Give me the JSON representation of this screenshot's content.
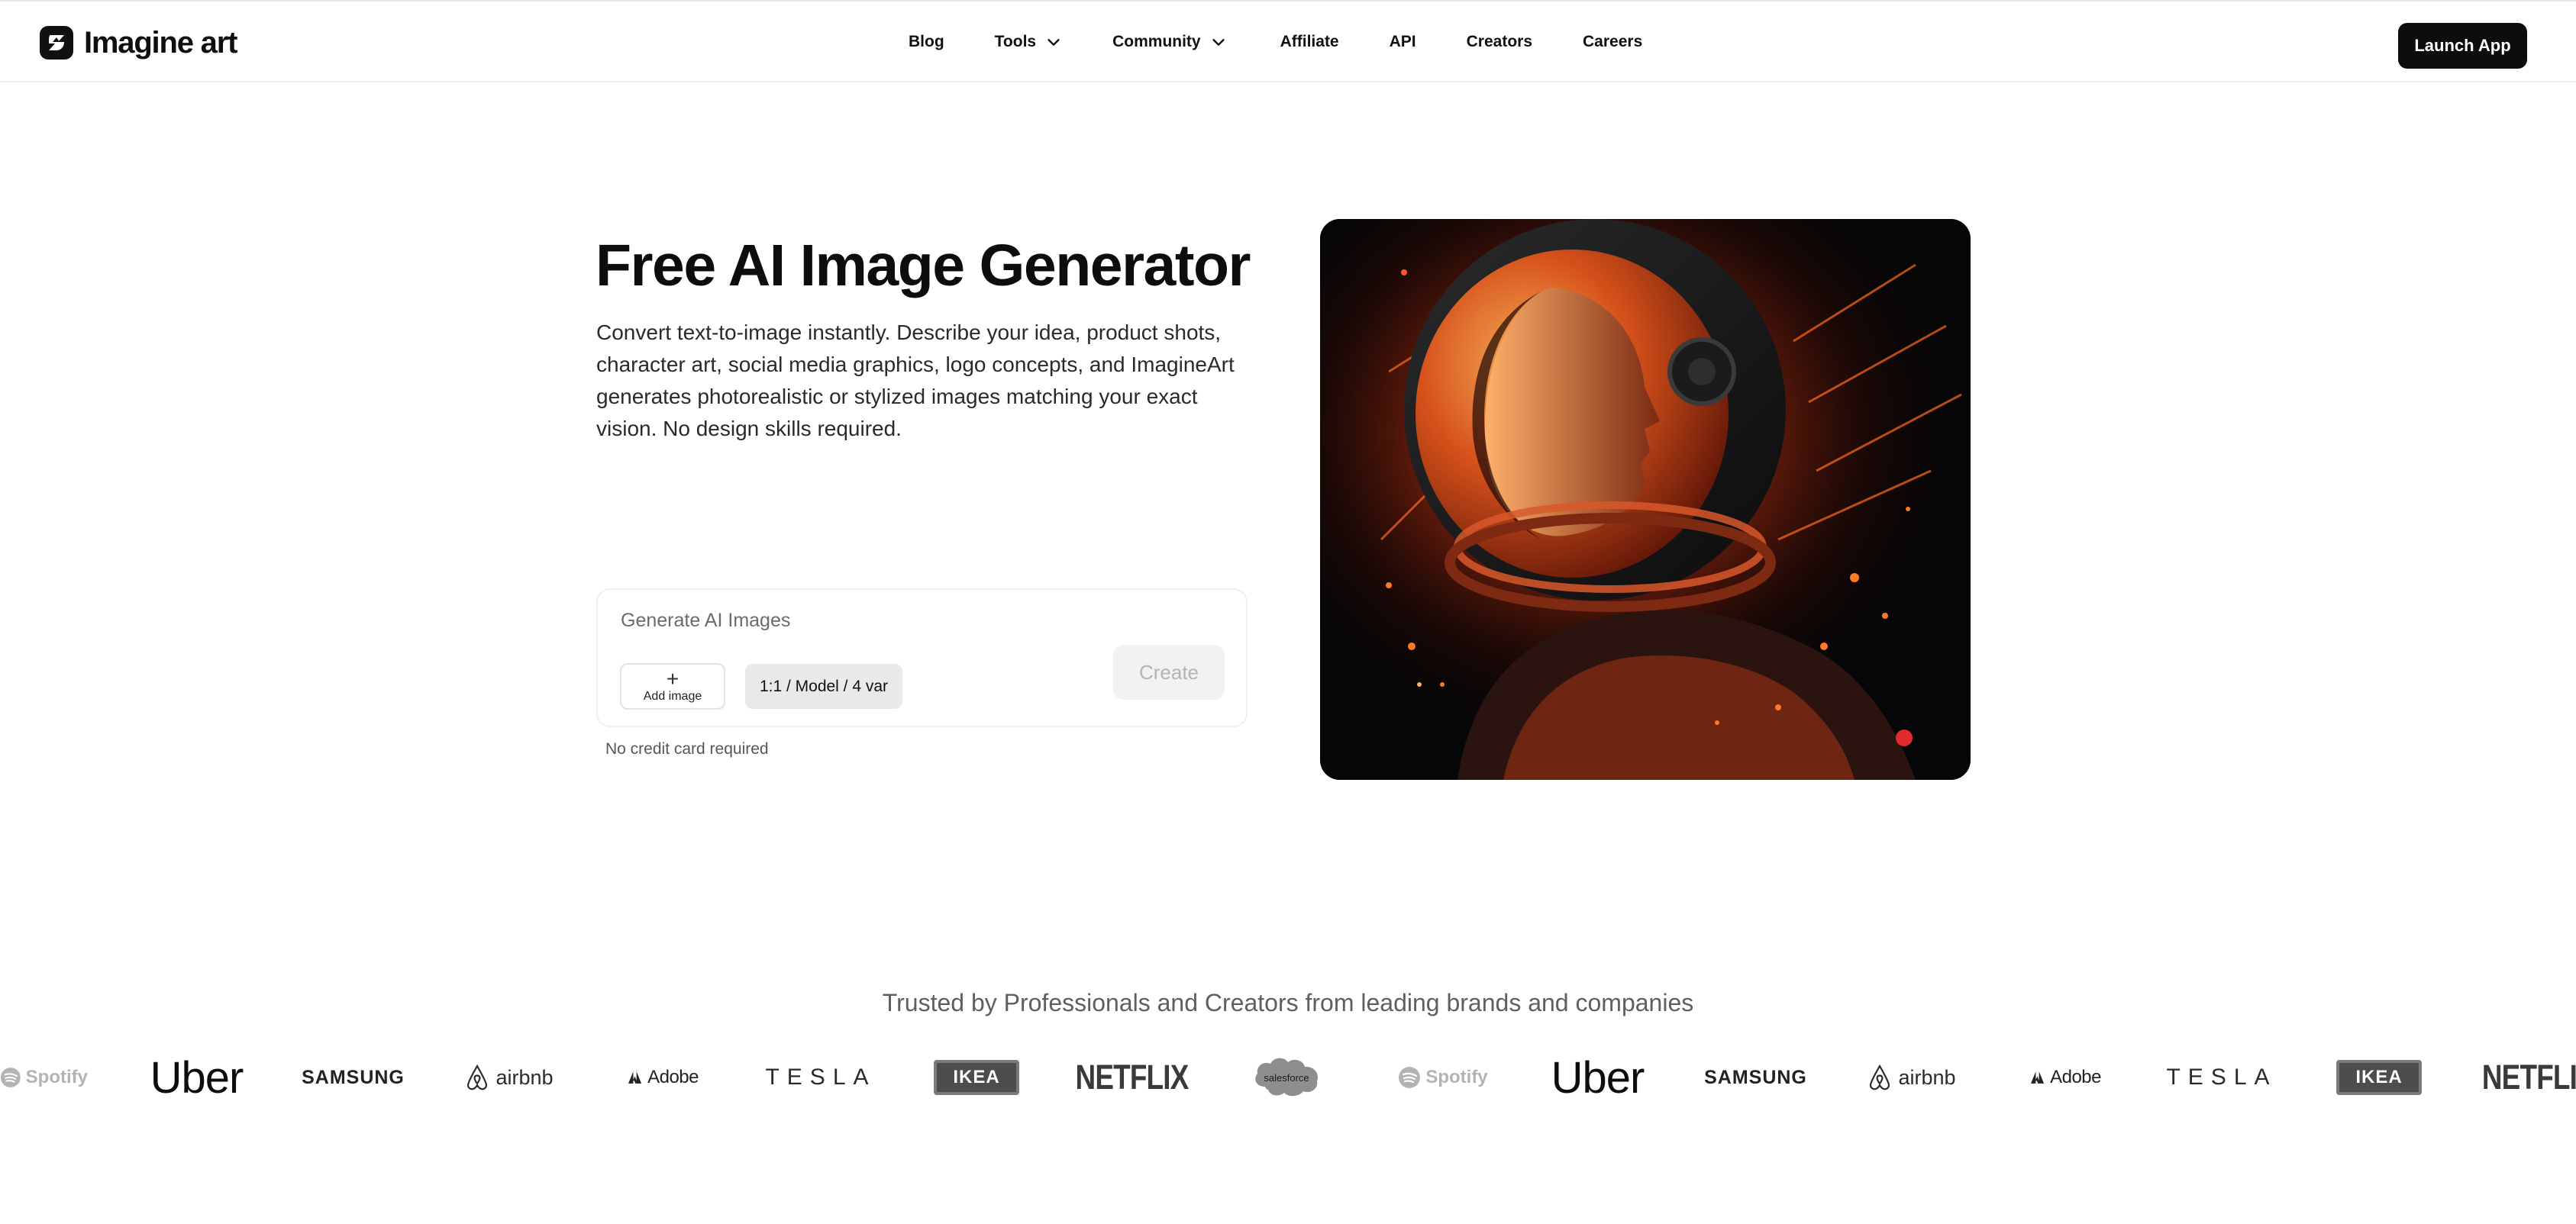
{
  "header": {
    "brand": "Imagine art",
    "nav": [
      {
        "label": "Blog"
      },
      {
        "label": "Tools",
        "has_dropdown": true
      },
      {
        "label": "Community",
        "has_dropdown": true
      },
      {
        "label": "Affiliate"
      },
      {
        "label": "API"
      },
      {
        "label": "Creators"
      },
      {
        "label": "Careers"
      }
    ],
    "cta": "Launch App"
  },
  "hero": {
    "title": "Free AI Image Generator",
    "description": "Convert text-to-image instantly. Describe your idea, product shots, character art, social media graphics, logo concepts, and ImagineArt generates photorealistic or stylized images matching your exact vision. No design skills required.",
    "generator": {
      "placeholder": "Generate AI Images",
      "add_image_label": "Add image",
      "settings_label": "1:1 / Model / 4 var",
      "create_label": "Create"
    },
    "note": "No credit card required",
    "image": {
      "subject": "astronaut-portrait"
    }
  },
  "trusted": {
    "heading": "Trusted by Professionals and Creators from leading brands and companies",
    "logos": [
      {
        "name": "Spotify",
        "text": "Spotify",
        "icon": "spotify-icon"
      },
      {
        "name": "Uber",
        "text": "Uber"
      },
      {
        "name": "Samsung",
        "text": "SAMSUNG"
      },
      {
        "name": "Airbnb",
        "text": "airbnb",
        "icon": "airbnb-icon"
      },
      {
        "name": "Adobe",
        "text": "Adobe",
        "icon": "adobe-icon"
      },
      {
        "name": "Tesla",
        "text": "TESLA"
      },
      {
        "name": "IKEA",
        "text": "IKEA"
      },
      {
        "name": "Netflix",
        "text": "NETFLIX"
      },
      {
        "name": "Salesforce",
        "text": "salesforce"
      },
      {
        "name": "Spotify",
        "text": "Spotify",
        "icon": "spotify-icon"
      },
      {
        "name": "Uber",
        "text": "Uber"
      },
      {
        "name": "Samsung",
        "text": "SAMSUNG"
      },
      {
        "name": "Airbnb",
        "text": "airbnb",
        "icon": "airbnb-icon"
      },
      {
        "name": "Adobe",
        "text": "Adobe",
        "icon": "adobe-icon"
      },
      {
        "name": "Tesla",
        "text": "TESLA"
      },
      {
        "name": "IKEA",
        "text": "IKEA"
      },
      {
        "name": "Netflix",
        "text": "NETFLIX"
      }
    ]
  },
  "colors": {
    "background": "#ffffff",
    "text": "#0d0d0d",
    "cta_bg": "#0d0d0d",
    "cta_text": "#ffffff",
    "muted": "#5f5f5f"
  }
}
